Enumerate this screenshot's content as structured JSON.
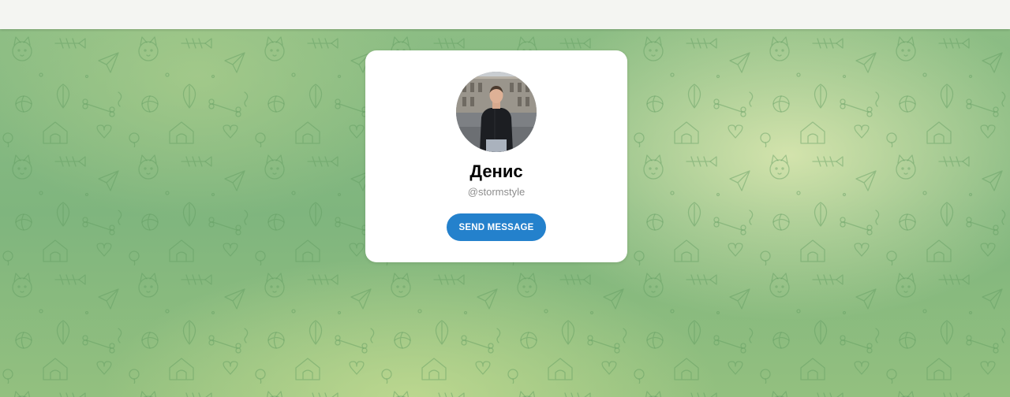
{
  "profile": {
    "name": "Денис",
    "username": "@stormstyle",
    "avatar_icon": "profile-photo"
  },
  "actions": {
    "send_message_label": "SEND MESSAGE"
  },
  "colors": {
    "accent": "#2481cc",
    "background_green": "#86ba80",
    "card": "#ffffff"
  }
}
